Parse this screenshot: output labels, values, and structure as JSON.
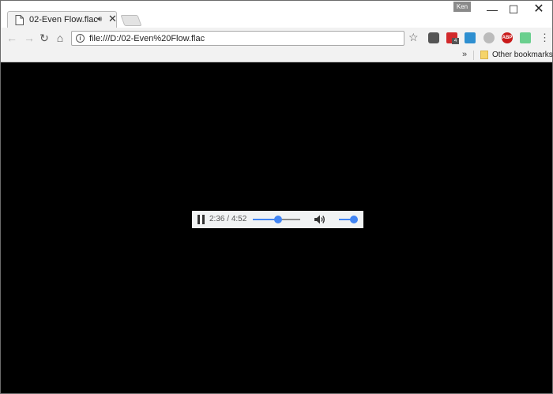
{
  "tab": {
    "title": "02-Even Flow.flac",
    "close_glyph": "✕"
  },
  "window": {
    "user_label": "Ken"
  },
  "omnibox": {
    "url": "file:///D:/02-Even%20Flow.flac"
  },
  "bookmarks": {
    "overflow_label": "»",
    "items": [
      {
        "label": "Other bookmarks"
      }
    ]
  },
  "player": {
    "current_time": "2:36",
    "separator": "/",
    "duration": "4:52",
    "progress_fraction": 0.53,
    "volume_fraction": 1.0
  },
  "extensions": {
    "abp_label": "ABP",
    "todo_badge": "4"
  },
  "colors": {
    "accent": "#4285f4",
    "page_background": "#000000",
    "player_background": "#f1f3f4"
  }
}
